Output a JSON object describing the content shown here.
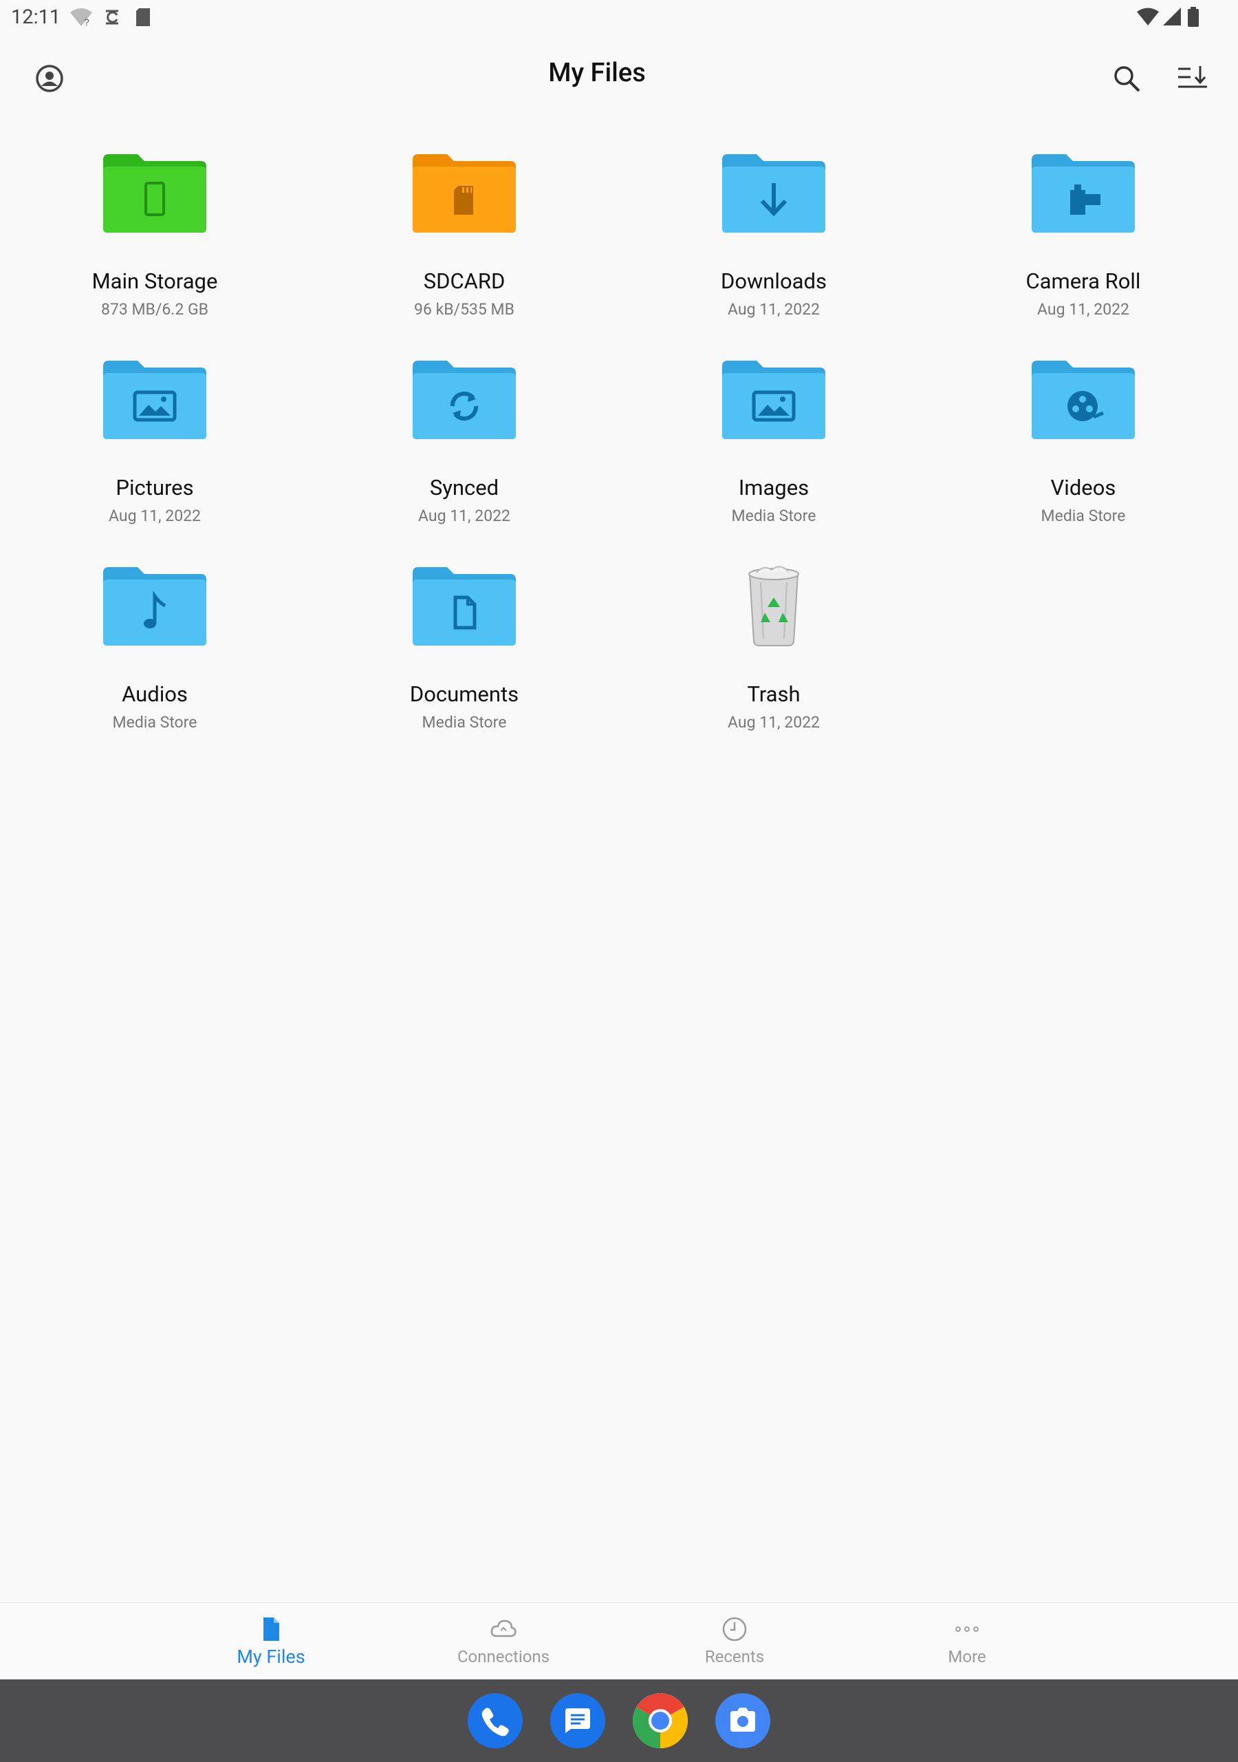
{
  "status": {
    "time": "12:11",
    "left_icons": [
      "wifi-question-icon",
      "sync-icon",
      "sdcard-icon"
    ],
    "right_icons": [
      "wifi-signal-icon",
      "cell-signal-icon",
      "battery-icon"
    ]
  },
  "header": {
    "title": "My Files",
    "icons": [
      "account-icon",
      "search-icon",
      "sort-icon"
    ]
  },
  "items": [
    {
      "name": "Main Storage",
      "sub": "873 MB/6.2 GB",
      "icon": "folder-phone-icon",
      "color": "#45d12a"
    },
    {
      "name": "SDCARD",
      "sub": "96 kB/535 MB",
      "icon": "folder-sdcard-icon",
      "color": "#ffa315"
    },
    {
      "name": "Downloads",
      "sub": "Aug 11, 2022",
      "icon": "folder-download-icon",
      "color": "#4fc1f5"
    },
    {
      "name": "Camera Roll",
      "sub": "Aug 11, 2022",
      "icon": "folder-camera-roll-icon",
      "color": "#4fc1f5"
    },
    {
      "name": "Pictures",
      "sub": "Aug 11, 2022",
      "icon": "folder-pictures-icon",
      "color": "#4fc1f5"
    },
    {
      "name": "Synced",
      "sub": "Aug 11, 2022",
      "icon": "folder-sync-icon",
      "color": "#4fc1f5"
    },
    {
      "name": "Images",
      "sub": "Media Store",
      "icon": "folder-images-icon",
      "color": "#4fc1f5"
    },
    {
      "name": "Videos",
      "sub": "Media Store",
      "icon": "folder-videos-icon",
      "color": "#4fc1f5"
    },
    {
      "name": "Audios",
      "sub": "Media Store",
      "icon": "folder-audio-icon",
      "color": "#4fc1f5"
    },
    {
      "name": "Documents",
      "sub": "Media Store",
      "icon": "folder-document-icon",
      "color": "#4fc1f5"
    },
    {
      "name": "Trash",
      "sub": "Aug 11, 2022",
      "icon": "trash-icon",
      "color": "#cfcfcf"
    }
  ],
  "nav": [
    {
      "label": "My Files",
      "icon": "file-icon",
      "active": true
    },
    {
      "label": "Connections",
      "icon": "cloud-icon",
      "active": false
    },
    {
      "label": "Recents",
      "icon": "clock-icon",
      "active": false
    },
    {
      "label": "More",
      "icon": "more-icon",
      "active": false
    }
  ],
  "dock": [
    {
      "icon": "phone-icon",
      "color": "#1a73e8"
    },
    {
      "icon": "messages-icon",
      "color": "#1a73e8"
    },
    {
      "icon": "chrome-icon",
      "color": "#ffffff"
    },
    {
      "icon": "camera-icon",
      "color": "#4285f4"
    }
  ],
  "colors": {
    "accent": "#1e88e5",
    "folder_blue": "#4fc1f5",
    "folder_green": "#45d12a",
    "folder_orange": "#ffa315"
  }
}
